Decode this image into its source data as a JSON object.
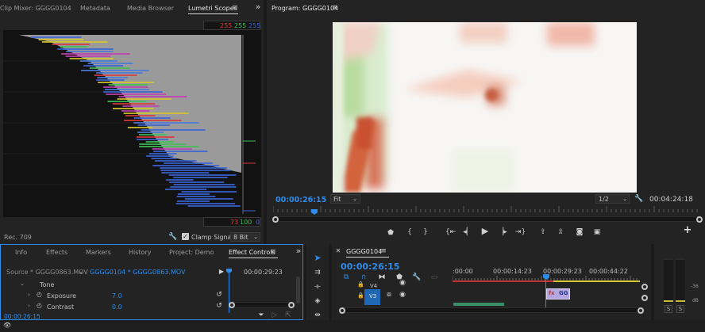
{
  "scopes_panel": {
    "tabs": [
      "Clip Mixer: GGGG0104",
      "Metadata",
      "Media Browser",
      "Lumetri Scopes"
    ],
    "menu_glyph": "≡",
    "overflow_glyph": "»",
    "top_values": [
      "255",
      "255",
      "255"
    ],
    "bottom_values": [
      "73",
      "100",
      "0"
    ],
    "standard_label": "Rec. 709",
    "clamp_label": "Clamp Signal",
    "bit_depth": "8 Bit",
    "colors": {
      "red": "#d63a3a",
      "green": "#3fbf56",
      "blue": "#3b63d4"
    }
  },
  "program_monitor": {
    "title": "Program: GGGG0104",
    "menu_glyph": "≡",
    "current_timecode": "00:00:26:15",
    "duration_timecode": "00:04:24:18",
    "zoom": "Fit",
    "resolution": "1/2",
    "transport_icons": [
      "marker-icon",
      "in-point-icon",
      "out-point-icon",
      "go-to-in-icon",
      "step-back-icon",
      "play-icon",
      "step-forward-icon",
      "go-to-out-icon",
      "lift-icon",
      "extract-icon",
      "export-frame-icon",
      "compare-icon"
    ],
    "add_glyph": "+"
  },
  "effect_controls": {
    "tabs": [
      "Info",
      "Effects",
      "Markers",
      "History",
      "Project: Demo",
      "Effect Controls"
    ],
    "menu_glyph": "≡",
    "overflow_glyph": "»",
    "source_label": "Source * GGGG0863.MOV",
    "sequence_label": "GGGG0104 * GGGG0863.MOV",
    "ruler_time": "00:00:29:23",
    "group_label": "Tone",
    "properties": [
      {
        "label": "Exposure",
        "value": "7.0"
      },
      {
        "label": "Contrast",
        "value": "0.0"
      }
    ],
    "timecode": "00:00:26:15"
  },
  "timeline": {
    "title": "GGGG0104",
    "menu_glyph": "≡",
    "timecode": "00:00:26:15",
    "ruler_labels": [
      ":00:00",
      "00:00:14:23",
      "00:00:29:23",
      "00:00:44:22"
    ],
    "tracks": [
      "V4",
      "V3"
    ],
    "clip_label": "GG",
    "clip_fx_label": "fx"
  },
  "audio_meter": {
    "db_labels": [
      "-36",
      "dB"
    ],
    "solo_labels": [
      "S",
      "S"
    ]
  },
  "tools": [
    "selection-tool-icon",
    "track-select-tool-icon",
    "ripple-edit-tool-icon",
    "razor-tool-icon",
    "slip-tool-icon"
  ]
}
